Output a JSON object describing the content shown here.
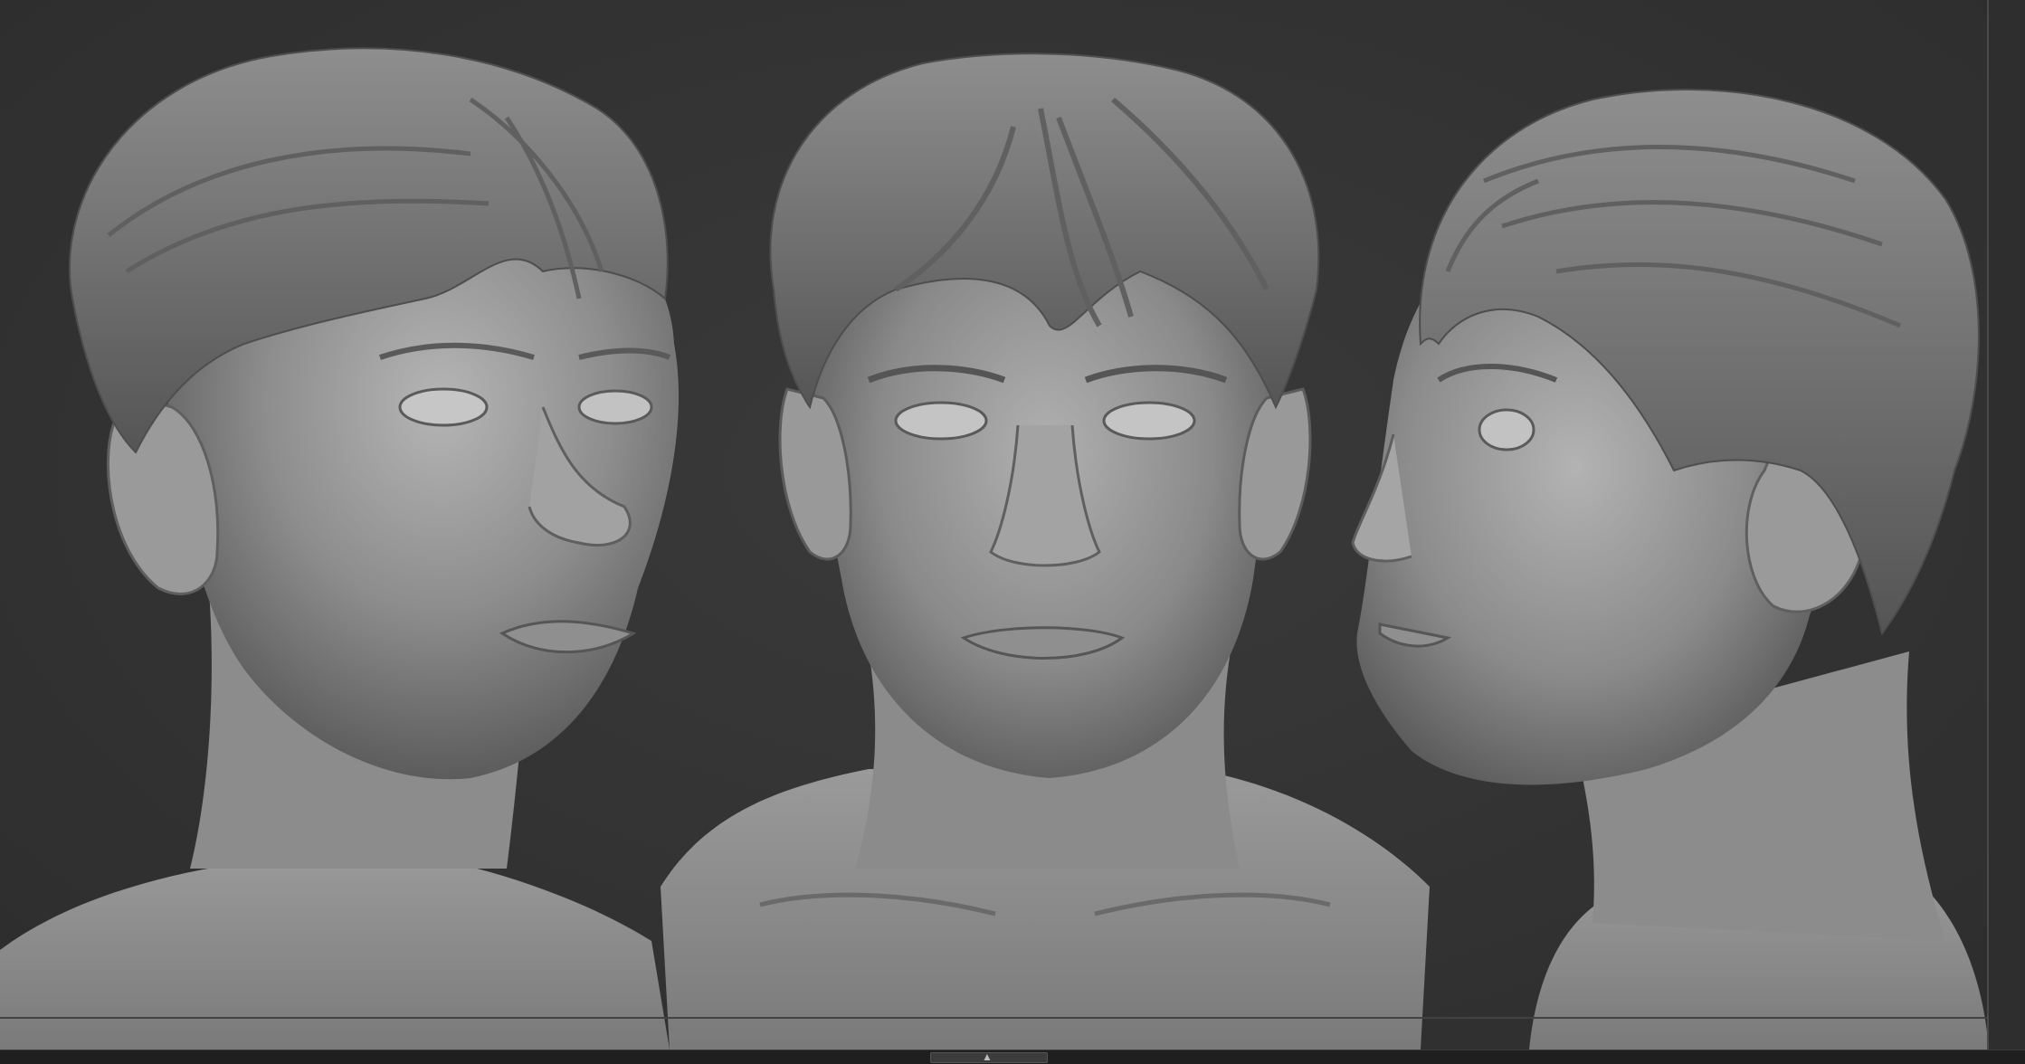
{
  "app": {
    "view": "3d-viewport-render",
    "accent_color": "#2a2a2a"
  },
  "viewport": {
    "background_color": "#333333",
    "material_color": "#8a8a8a"
  },
  "bottom_tray": {
    "handle_icon": "expand-collapse-icon"
  }
}
